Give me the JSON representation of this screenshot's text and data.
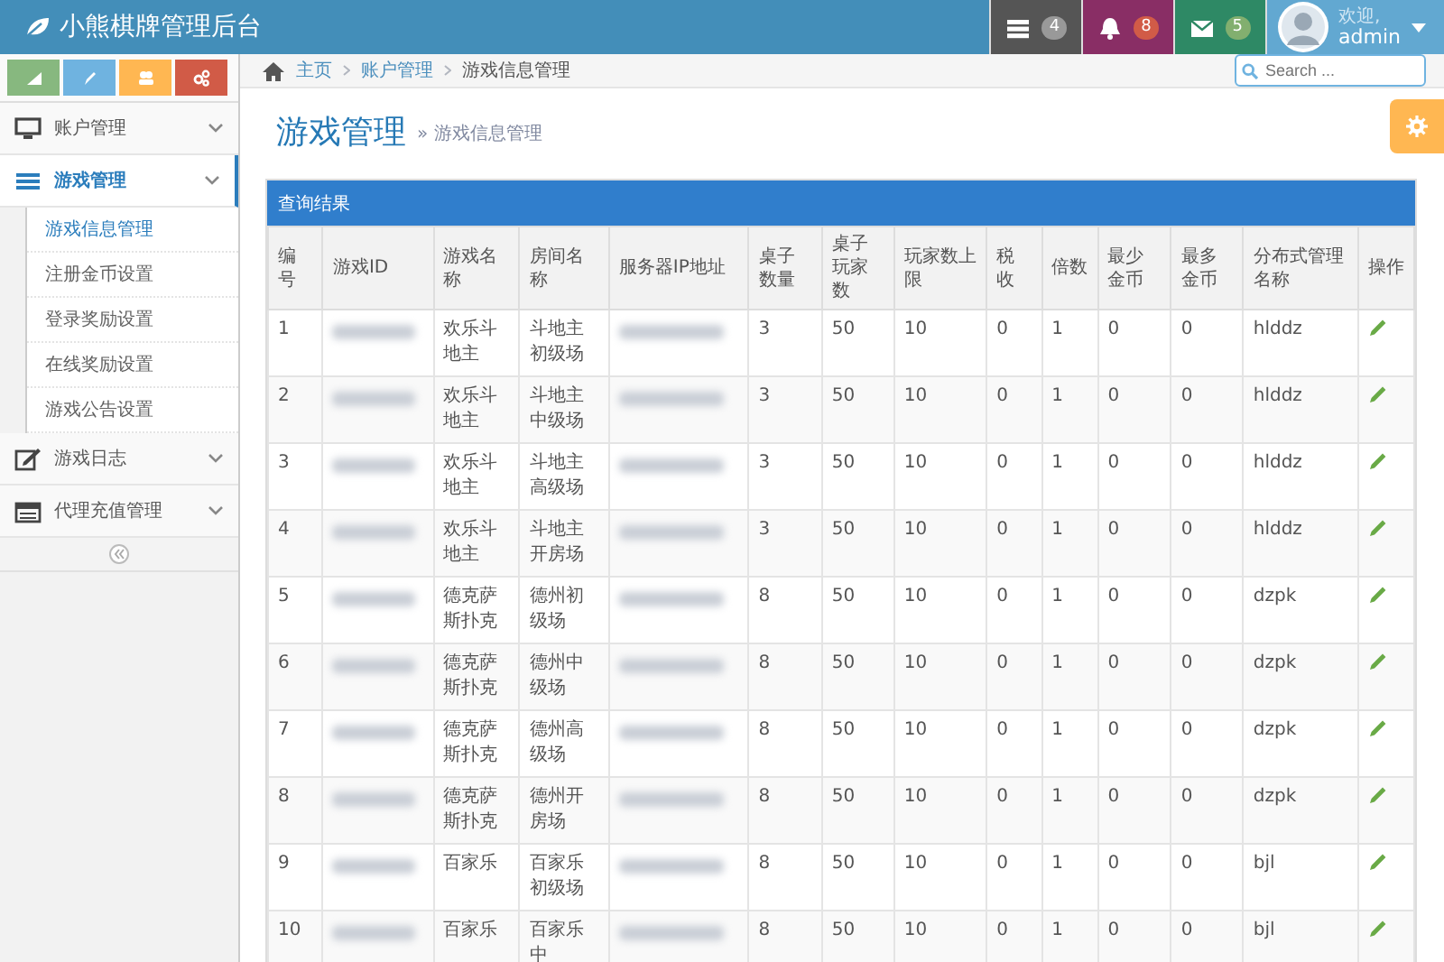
{
  "app": {
    "title": "小熊棋牌管理后台"
  },
  "navbar": {
    "notifications": [
      {
        "kind": "tasks",
        "count": "4"
      },
      {
        "kind": "alerts",
        "count": "8"
      },
      {
        "kind": "messages",
        "count": "5"
      }
    ],
    "user": {
      "greeting": "欢迎,",
      "name": "admin"
    }
  },
  "sidebar": {
    "items": [
      {
        "kind": "desktop",
        "label": "账户管理",
        "selected": false
      },
      {
        "kind": "list",
        "label": "游戏管理",
        "selected": true,
        "expanded": true,
        "children": [
          {
            "label": "游戏信息管理",
            "selected": true
          },
          {
            "label": "注册金币设置",
            "selected": false
          },
          {
            "label": "登录奖励设置",
            "selected": false
          },
          {
            "label": "在线奖励设置",
            "selected": false
          },
          {
            "label": "游戏公告设置",
            "selected": false
          }
        ]
      },
      {
        "kind": "edit",
        "label": "游戏日志",
        "selected": false
      },
      {
        "kind": "calendar",
        "label": "代理充值管理",
        "selected": false
      }
    ]
  },
  "breadcrumb": [
    "主页",
    "账户管理",
    "游戏信息管理"
  ],
  "search": {
    "placeholder": "Search ..."
  },
  "page_header": {
    "title": "游戏管理",
    "subtitle": "» 游戏信息管理"
  },
  "panel": {
    "title": "查询结果"
  },
  "table": {
    "columns": [
      "编号",
      "游戏ID",
      "游戏名称",
      "房间名称",
      "服务器IP地址",
      "桌子数量",
      "桌子玩家数",
      "玩家数上限",
      "税收",
      "倍数",
      "最少金币",
      "最多金币",
      "分布式管理名称",
      "操作"
    ],
    "rows": [
      [
        "1",
        null,
        "欢乐斗地主",
        "斗地主初级场",
        null,
        "3",
        "50",
        "10",
        "0",
        "1",
        "0",
        "0",
        "hlddz"
      ],
      [
        "2",
        null,
        "欢乐斗地主",
        "斗地主中级场",
        null,
        "3",
        "50",
        "10",
        "0",
        "1",
        "0",
        "0",
        "hlddz"
      ],
      [
        "3",
        null,
        "欢乐斗地主",
        "斗地主高级场",
        null,
        "3",
        "50",
        "10",
        "0",
        "1",
        "0",
        "0",
        "hlddz"
      ],
      [
        "4",
        null,
        "欢乐斗地主",
        "斗地主开房场",
        null,
        "3",
        "50",
        "10",
        "0",
        "1",
        "0",
        "0",
        "hlddz"
      ],
      [
        "5",
        null,
        "德克萨斯扑克",
        "德州初级场",
        null,
        "8",
        "50",
        "10",
        "0",
        "1",
        "0",
        "0",
        "dzpk"
      ],
      [
        "6",
        null,
        "德克萨斯扑克",
        "德州中级场",
        null,
        "8",
        "50",
        "10",
        "0",
        "1",
        "0",
        "0",
        "dzpk"
      ],
      [
        "7",
        null,
        "德克萨斯扑克",
        "德州高级场",
        null,
        "8",
        "50",
        "10",
        "0",
        "1",
        "0",
        "0",
        "dzpk"
      ],
      [
        "8",
        null,
        "德克萨斯扑克",
        "德州开房场",
        null,
        "8",
        "50",
        "10",
        "0",
        "1",
        "0",
        "0",
        "dzpk"
      ],
      [
        "9",
        null,
        "百家乐",
        "百家乐初级场",
        null,
        "8",
        "50",
        "10",
        "0",
        "1",
        "0",
        "0",
        "bjl"
      ],
      [
        "10",
        null,
        "百家乐",
        "百家乐中",
        null,
        "8",
        "50",
        "10",
        "0",
        "1",
        "0",
        "0",
        "bjl"
      ]
    ]
  }
}
